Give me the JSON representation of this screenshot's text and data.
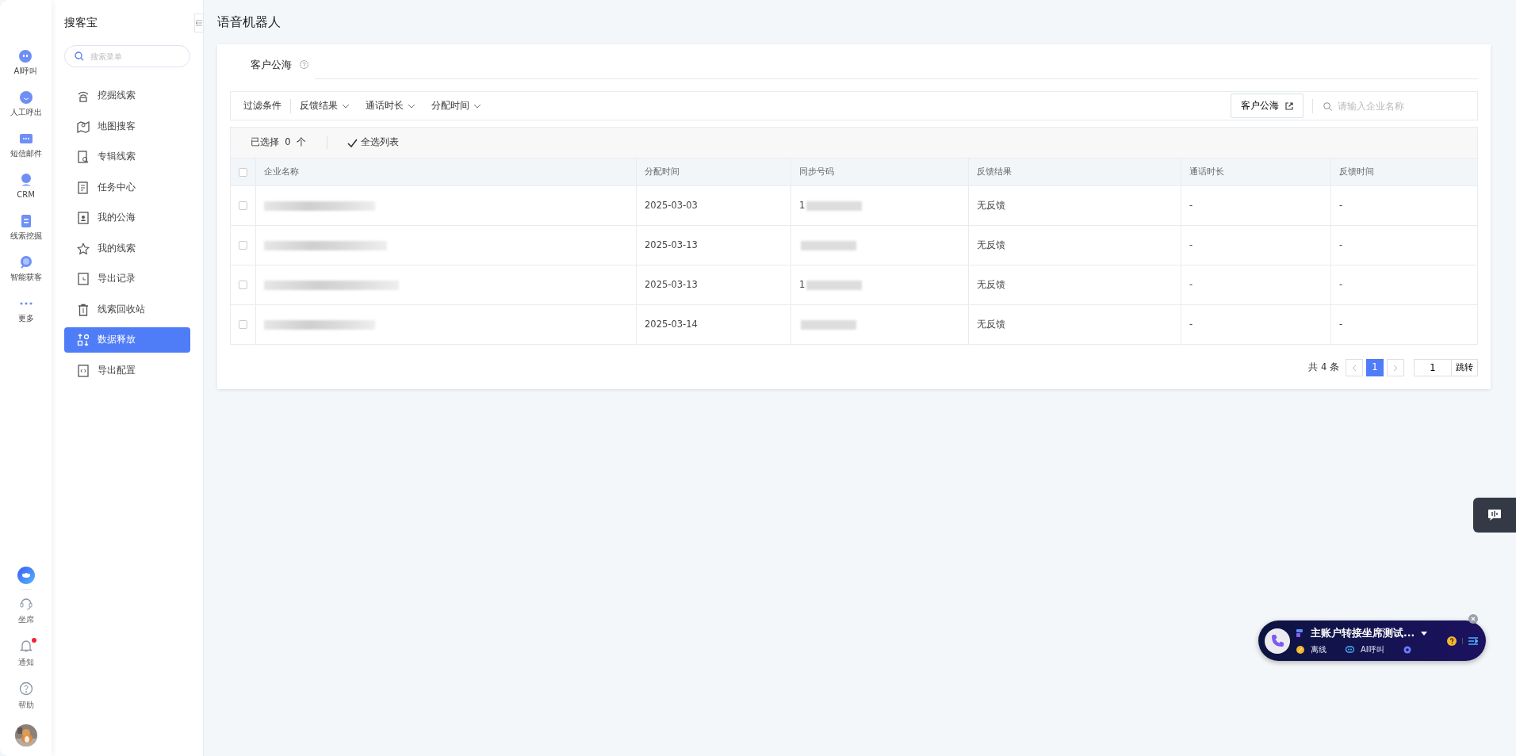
{
  "rail": {
    "items": [
      {
        "label": "AI呼叫",
        "kind": "robot"
      },
      {
        "label": "人工呼出",
        "kind": "smile"
      },
      {
        "label": "短信邮件",
        "kind": "message"
      },
      {
        "label": "CRM",
        "kind": "person"
      },
      {
        "label": "线索挖掘",
        "kind": "doc"
      },
      {
        "label": "智能获客",
        "kind": "search"
      },
      {
        "label": "更多",
        "kind": "dots"
      }
    ],
    "bottom": [
      {
        "label": "坐席",
        "kind": "headset",
        "badge": false
      },
      {
        "label": "通知",
        "kind": "bell",
        "badge": true
      },
      {
        "label": "帮助",
        "kind": "help",
        "badge": false
      }
    ]
  },
  "sidebar": {
    "title": "搜客宝",
    "search": {
      "placeholder": "搜索菜单"
    },
    "items": [
      {
        "label": "挖掘线索",
        "kind": "antenna",
        "selected": false
      },
      {
        "label": "地图搜客",
        "kind": "map",
        "selected": false
      },
      {
        "label": "专辑线索",
        "kind": "docsearch",
        "selected": false
      },
      {
        "label": "任务中心",
        "kind": "list",
        "selected": false
      },
      {
        "label": "我的公海",
        "kind": "contact",
        "selected": false
      },
      {
        "label": "我的线索",
        "kind": "star",
        "selected": false
      },
      {
        "label": "导出记录",
        "kind": "clockdoc",
        "selected": false
      },
      {
        "label": "线索回收站",
        "kind": "trash",
        "selected": false
      },
      {
        "label": "数据释放",
        "kind": "release",
        "selected": true
      },
      {
        "label": "导出配置",
        "kind": "code",
        "selected": false
      }
    ]
  },
  "page_title": "语音机器人",
  "tabs": [
    {
      "label": "客户公海",
      "selected": true
    }
  ],
  "filters": {
    "label": "过滤条件",
    "dropdowns": [
      "反馈结果",
      "通话时长",
      "分配时间"
    ],
    "button": "客户公海",
    "search": {
      "placeholder": "请输入企业名称"
    }
  },
  "selection": {
    "label": "已选择",
    "count": "0",
    "unit": "个",
    "select_all": "全选列表"
  },
  "table": {
    "all_checked": false,
    "columns": [
      "企业名称",
      "分配时间",
      "同步号码",
      "反馈结果",
      "通话时长",
      "反馈时间"
    ],
    "rows": [
      {
        "checked": false,
        "company_redacted": true,
        "assign_time": "2025-03-03",
        "phone": "1",
        "feedback": "无反馈",
        "duration": "-",
        "feedback_time": "-"
      },
      {
        "checked": false,
        "company_redacted": true,
        "assign_time": "2025-03-13",
        "feedback": "无反馈",
        "duration": "-",
        "feedback_time": "-"
      },
      {
        "checked": false,
        "company_redacted": true,
        "assign_time": "2025-03-13",
        "phone": "1",
        "feedback": "无反馈",
        "duration": "-",
        "feedback_time": "-"
      },
      {
        "checked": false,
        "company_redacted": true,
        "assign_time": "2025-03-14",
        "feedback": "无反馈",
        "duration": "-",
        "feedback_time": "-"
      }
    ]
  },
  "pagination": {
    "total": "共 4 条",
    "pages": [
      {
        "label": "1",
        "selected": true
      }
    ],
    "jump_value": "1",
    "jump_button": "跳转"
  },
  "call_widget": {
    "title": "主账户转接坐席测试...",
    "status": "离线",
    "mode": "AI呼叫"
  }
}
